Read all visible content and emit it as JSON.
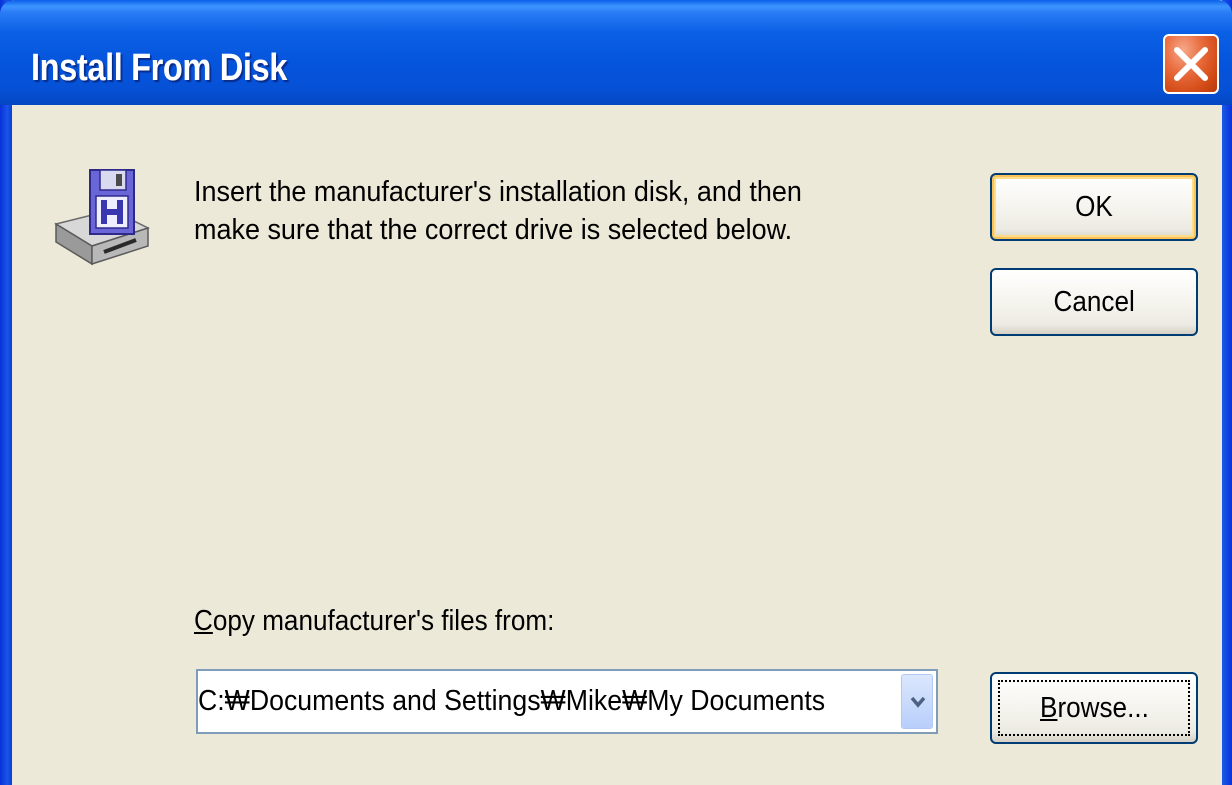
{
  "window": {
    "title": "Install From Disk"
  },
  "dialog": {
    "instruction_line1": "Insert the manufacturer's installation disk, and then",
    "instruction_line2": "make sure that the correct drive is selected below.",
    "copy_label_first": "C",
    "copy_label_rest": "opy manufacturer's files from:",
    "path_value": "C:₩Documents and Settings₩Mike₩My Documents"
  },
  "buttons": {
    "ok": "OK",
    "cancel": "Cancel",
    "browse_first": "B",
    "browse_rest": "rowse..."
  },
  "icons": {
    "disk": "floppy-drive-icon",
    "close": "close-icon",
    "dropdown": "chevron-down-icon"
  },
  "colors": {
    "titlebar": "#0554dc",
    "dialog_bg": "#ece9d8",
    "close_button": "#d24a15",
    "button_border": "#003c74",
    "ok_focus": "#f9c35a"
  }
}
